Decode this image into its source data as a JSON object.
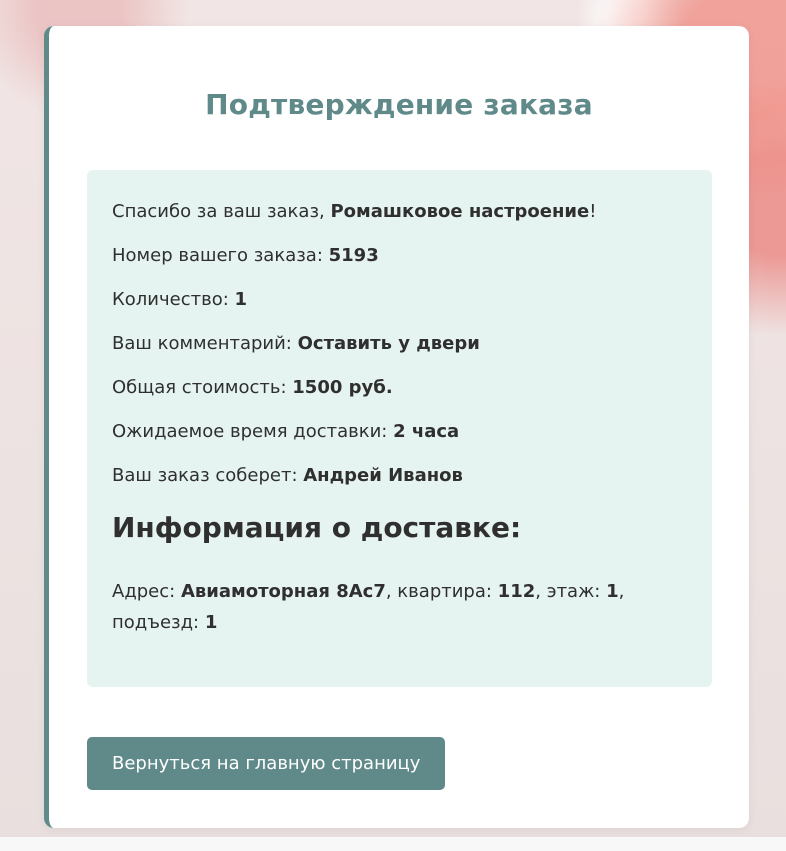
{
  "title": "Подтверждение заказа",
  "order": {
    "thanks_prefix": "Спасибо за ваш заказ, ",
    "bouquet_name": "Ромашковое настроение",
    "thanks_suffix": "!",
    "number_label": "Номер вашего заказа: ",
    "number_value": "5193",
    "quantity_label": "Количество: ",
    "quantity_value": "1",
    "comment_label": "Ваш комментарий: ",
    "comment_value": "Оставить у двери",
    "total_label": "Общая стоимость: ",
    "total_value": "1500 руб.",
    "delivery_time_label": "Ожидаемое время доставки: ",
    "delivery_time_value": "2 часа",
    "florist_label": "Ваш заказ соберет: ",
    "florist_value": "Андрей Иванов"
  },
  "delivery": {
    "heading": "Информация о доставке:",
    "address_label": "Адрес: ",
    "address_value": "Авиамоторная 8Ас7",
    "apartment_label": ", квартира: ",
    "apartment_value": "112",
    "floor_label": ", этаж: ",
    "floor_value": "1",
    "entrance_label": ", подъезд: ",
    "entrance_value": "1"
  },
  "actions": {
    "back_label": "Вернуться на главную страницу"
  },
  "colors": {
    "accent": "#5f8a89",
    "panel_background": "#e6f4f1",
    "text": "#2f2f2f"
  }
}
